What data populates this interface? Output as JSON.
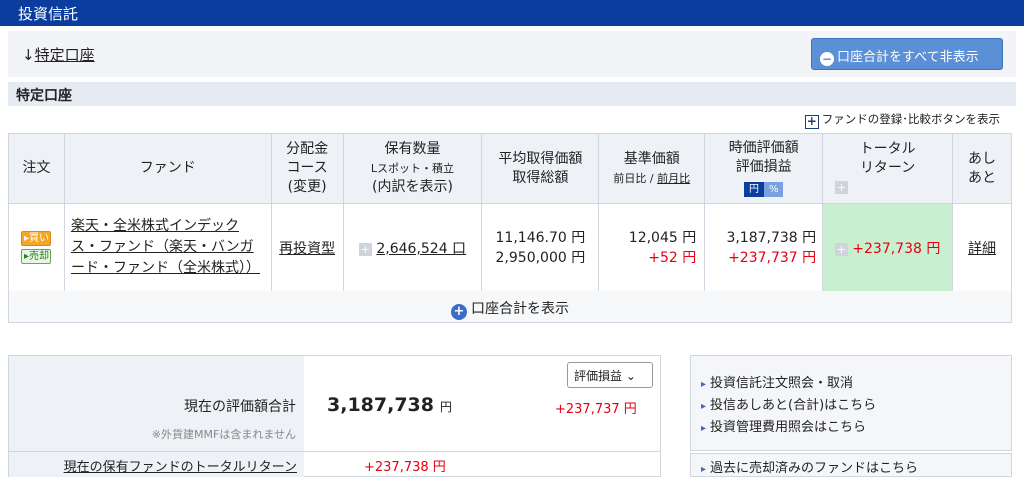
{
  "header": {
    "title": "投資信託"
  },
  "account_link": {
    "arrow": "↓",
    "label": "特定口座"
  },
  "hide_all_button": {
    "icon": "minus-circle-icon",
    "label": "口座合計をすべて非表示"
  },
  "section_title": "特定口座",
  "fund_register_link": "ファンドの登録･比較ボタンを表示",
  "table": {
    "headers": {
      "order": "注文",
      "fund": "ファンド",
      "dist1": "分配金",
      "dist2": "コース",
      "dist3": "(変更)",
      "qty1": "保有数量",
      "qty2": "Lスポット・積立",
      "qty3": "(内訳を表示)",
      "avg1": "平均取得価額",
      "avg2": "取得総額",
      "base1": "基準価額",
      "base2a": "前日比",
      "base2sep": " / ",
      "base2b": "前月比",
      "market1": "時価評価額",
      "market2": "評価損益",
      "yen_btn": "円",
      "pct_btn": "%",
      "total1": "トータル",
      "total2": "リターン",
      "history1": "あし",
      "history2": "あと"
    },
    "row": {
      "buy": "買い",
      "sell": "売却",
      "fund_name": "楽天・全米株式インデックス・ファンド（楽天・バンガード・ファンド（全米株式））",
      "course": "再投資型",
      "quantity": "2,646,524 口",
      "avg_price": "11,146.70 円",
      "acq_total": "2,950,000 円",
      "base_price": "12,045 円",
      "base_diff": "+52 円",
      "market_value": "3,187,738 円",
      "unrealized": "+237,737 円",
      "total_return": "+237,738 円",
      "detail": "詳細"
    }
  },
  "show_total": "口座合計を表示",
  "summary": {
    "label": "現在の評価額合計",
    "note": "※外貨建MMFは含まれません",
    "value": "3,187,738",
    "yen": "円",
    "select": "評価損益",
    "diff": "+237,737 円",
    "return_label": "現在の保有ファンドのトータルリターン",
    "return_value": "+237,738 円"
  },
  "links": [
    "投資信託注文照会・取消",
    "投信あしあと(合計)はこちら",
    "投資管理費用照会はこちら"
  ],
  "past_link": "過去に売却済みのファンドはこちら"
}
